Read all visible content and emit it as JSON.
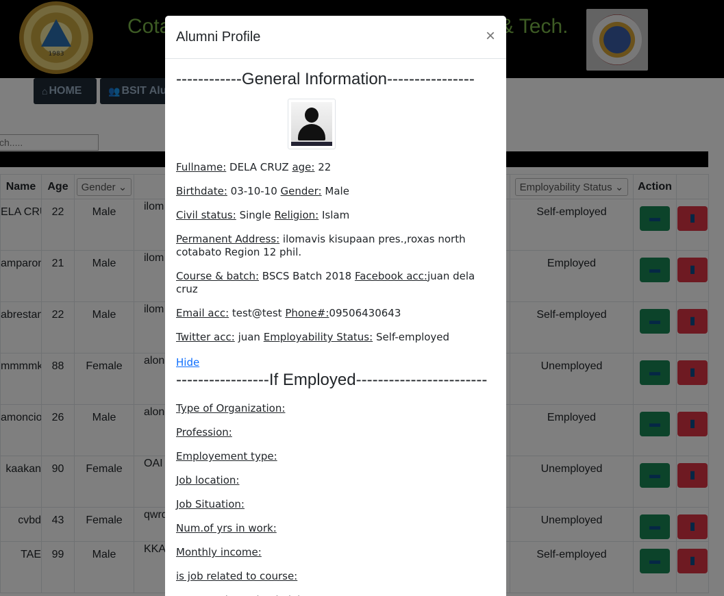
{
  "header": {
    "title_left": "Cota",
    "title_right": "& Tech.",
    "logo_left_year": "1983"
  },
  "nav": {
    "home_label": "HOME",
    "alumni_label": "BSIT Alu"
  },
  "search": {
    "placeholder": "ch....."
  },
  "table": {
    "columns": [
      "Name",
      "Age",
      "Gender",
      "",
      "Employability Status",
      "Action"
    ],
    "rows": [
      {
        "name": "ELA CRUZ",
        "age": "22",
        "gender": "Male",
        "address": "ilom",
        "status": "Self-employed"
      },
      {
        "name": "amparong",
        "age": "21",
        "gender": "Male",
        "address": "ilom",
        "status": "Employed"
      },
      {
        "name": "abrestante",
        "age": "22",
        "gender": "Male",
        "address": "ilom",
        "status": "Self-employed"
      },
      {
        "name": "mmmmkk",
        "age": "88",
        "gender": "Female",
        "address": "along",
        "status": "Unemployed"
      },
      {
        "name": "amoncio",
        "age": "26",
        "gender": "Male",
        "address": "along",
        "status": "Employed"
      },
      {
        "name": "kaakan",
        "age": "90",
        "gender": "Female",
        "address": "OAI",
        "status": "Unemployed"
      },
      {
        "name": "cvbd",
        "age": "43",
        "gender": "Female",
        "address": "qwrq",
        "status": "Unemployed"
      },
      {
        "name": "TAE",
        "age": "99",
        "gender": "Male",
        "address": "KKA",
        "status": "Self-employed"
      }
    ]
  },
  "modal": {
    "title": "Alumni Profile",
    "close": "×",
    "general_heading": "------------General Information----------------",
    "fields": {
      "fullname_label": "Fullname:",
      "fullname": "DELA CRUZ",
      "age_label": "age:",
      "age": "22",
      "birthdate_label": "Birthdate:",
      "birthdate": "03-10-10",
      "gender_label": "Gender:",
      "gender": "Male",
      "civil_label": "Civil status:",
      "civil": "Single",
      "religion_label": "Religion:",
      "religion": "Islam",
      "address_label": "Permanent Address:",
      "address": "ilomavis kisupaan pres.,roxas north cotabato Region 12 phil.",
      "course_label": "Course & batch:",
      "course": "BSCS Batch 2018",
      "facebook_label": "Facebook acc:",
      "facebook": "juan dela cruz",
      "email_label": "Email acc:",
      "email": "test@test",
      "phone_label": "Phone#:",
      "phone": "09506430643",
      "twitter_label": "Twitter acc:",
      "twitter": "juan",
      "emp_status_label": "Employability Status:",
      "emp_status": "Self-employed"
    },
    "hide_link": "Hide",
    "employed_heading": "-----------------If Employed------------------------",
    "employed_fields": [
      "Type of Organization:",
      "Profession:",
      "Employement type:",
      "Job location:",
      "Job Situation:",
      "Num.of yrs in work:",
      "Monthly income:",
      "is job related to course:",
      "Reason why stying in job:"
    ]
  }
}
